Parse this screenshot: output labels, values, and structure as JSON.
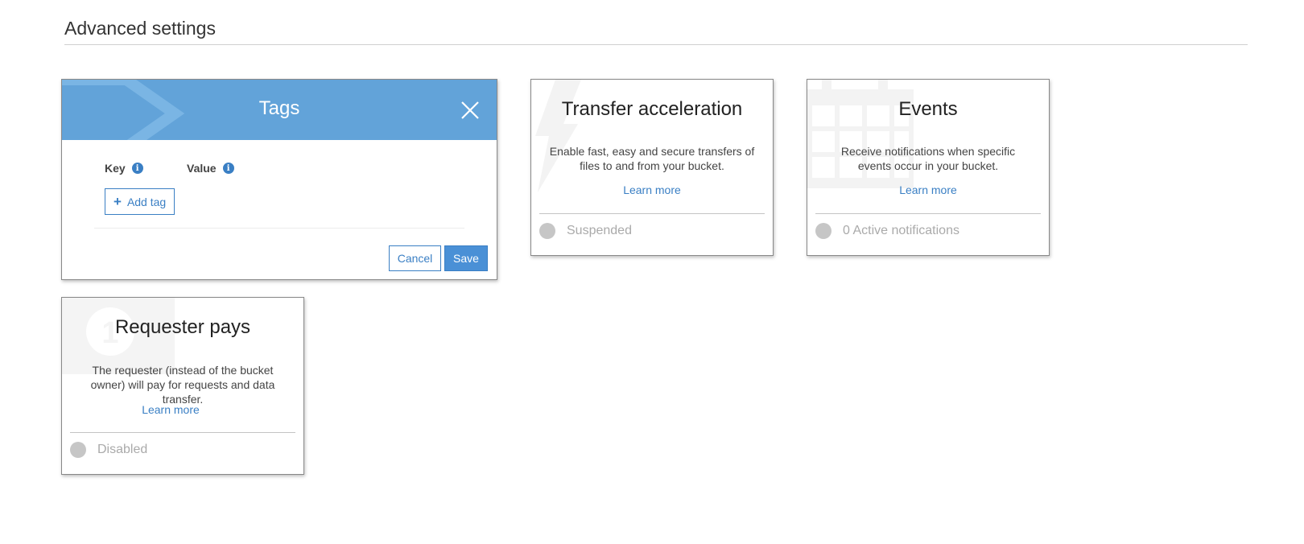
{
  "section": {
    "title": "Advanced settings"
  },
  "tags_card": {
    "title": "Tags",
    "key_label": "Key",
    "value_label": "Value",
    "add_tag_label": "Add tag",
    "cancel_label": "Cancel",
    "save_label": "Save",
    "icons": {
      "close": "close-icon",
      "info": "info-icon",
      "add": "plus-icon"
    }
  },
  "transfer_acceleration": {
    "title": "Transfer acceleration",
    "description": "Enable fast, easy and secure transfers of files to and from your bucket.",
    "link": "Learn more",
    "status": "Suspended",
    "icon": "lightning-icon"
  },
  "events": {
    "title": "Events",
    "description": "Receive notifications when specific events occur in your bucket.",
    "link": "Learn more",
    "status": "0 Active notifications",
    "icon": "calendar-icon"
  },
  "requester_pays": {
    "title": "Requester pays",
    "description": "The requester (instead of the bucket owner) will pay for requests and data transfer.",
    "link": "Learn more",
    "status": "Disabled",
    "icon": "money-icon"
  },
  "colors": {
    "accent": "#3a7fc4",
    "header": "#62a3d9",
    "status_dot": "#c6c6c6"
  }
}
